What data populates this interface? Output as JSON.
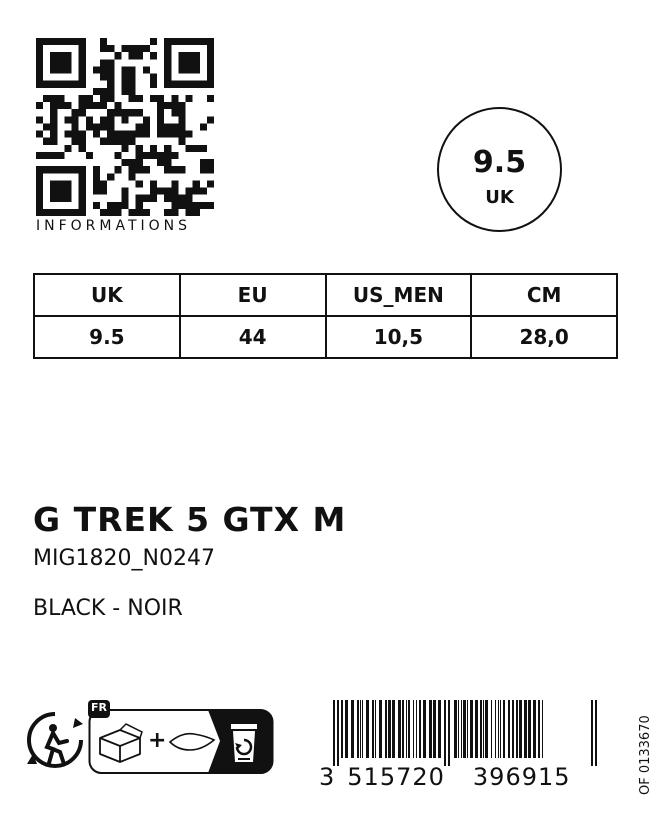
{
  "qr": {
    "label": "INFORMATIONS"
  },
  "size": {
    "value": "9.5",
    "unit": "UK"
  },
  "table": {
    "headers": [
      "UK",
      "EU",
      "US_MEN",
      "CM"
    ],
    "values": [
      "9.5",
      "44",
      "10,5",
      "28,0"
    ]
  },
  "product": {
    "name": "G TREK 5 GTX M",
    "code": "MIG1820_N0247",
    "color": "BLACK - NOIR"
  },
  "recycling": {
    "country": "FR",
    "plus": "+"
  },
  "barcode": {
    "first": "3",
    "left_group": "515720",
    "right_group": "396915"
  },
  "ref_code": "OF 0133670",
  "icons": [
    "qr-code-icon",
    "triman-icon",
    "box-icon",
    "paper-icon",
    "recycle-bin-icon",
    "barcode-icon"
  ]
}
